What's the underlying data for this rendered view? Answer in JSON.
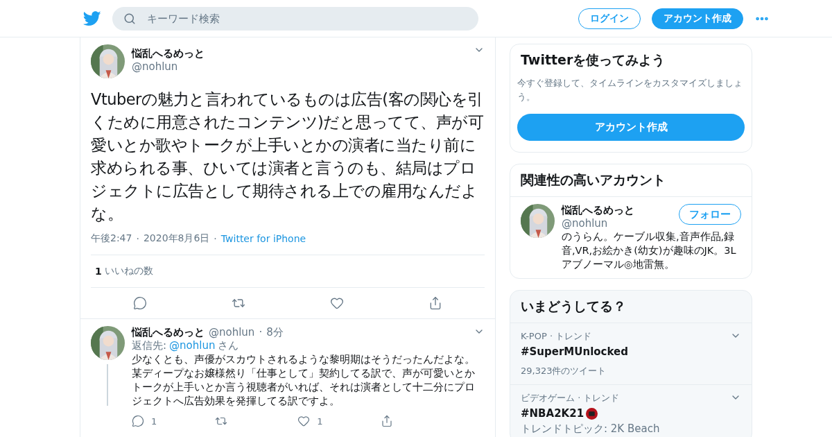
{
  "header": {
    "search": {
      "placeholder": "キーワード検索"
    },
    "login": "ログイン",
    "signup": "アカウント作成"
  },
  "tweet": {
    "name": "悩乱へるめっと",
    "handle": "@nohlun",
    "text": "Vtuberの魅力と言われているものは広告(客の関心を引くために用意されたコンテンツ)だと思ってて、声が可愛いとか歌やトークが上手いとかの演者に当たり前に求められる事、ひいては演者と言うのも、結局はプロジェクトに広告として期待される上での雇用なんだよな。",
    "time": "午後2:47",
    "separator": "·",
    "date": "2020年8月6日",
    "source": "Twitter for iPhone",
    "likes_count": "1",
    "likes_label": "いいねの数",
    "actions": [
      {
        "kind": "reply"
      },
      {
        "kind": "retweet"
      },
      {
        "kind": "like"
      },
      {
        "kind": "share"
      }
    ]
  },
  "reply": {
    "name": "悩乱へるめっと",
    "handle": "@nohlun",
    "separator": "·",
    "time": "8分",
    "reply_to_label": "返信先:",
    "reply_to_handle": "@nohlun",
    "reply_to_suffix": "さん",
    "text": "少なくとも、声優がスカウトされるような黎明期はそうだったんだよな。某ディープなお嬢様然り「仕事として」契約してる訳で、声が可愛いとかトークが上手いとか言う視聴者がいれば、それは演者として十二分にプロジェクトへ広告効果を発揮してる訳ですよ。",
    "actions": [
      {
        "kind": "reply",
        "count": "1"
      },
      {
        "kind": "retweet"
      },
      {
        "kind": "like",
        "count": "1"
      },
      {
        "kind": "share"
      }
    ]
  },
  "signup_card": {
    "title": "Twitterを使ってみよう",
    "description": "今すぐ登録して、タイムラインをカスタマイズしましょう。",
    "button": "アカウント作成"
  },
  "related_card": {
    "title": "関連性の高いアカウント",
    "accounts": [
      {
        "name": "悩乱へるめっと",
        "handle": "@nohlun",
        "follow": "フォロー",
        "bio": "のうらん。ケーブル収集,音声作品,録音,VR,お絵かき(幼女)が趣味のJK。3Lアブノーマル◎地雷無。"
      }
    ]
  },
  "trends_card": {
    "title": "いまどうしてる？",
    "trends": [
      {
        "context": "K-POP · トレンド",
        "name": "#SuperMUnlocked",
        "badge": false,
        "count": "29,323件のツイート"
      },
      {
        "context": "ビデオゲーム · トレンド",
        "name": "#NBA2K21",
        "badge": true,
        "topic": "トレンドトピック: 2K Beach"
      }
    ]
  }
}
